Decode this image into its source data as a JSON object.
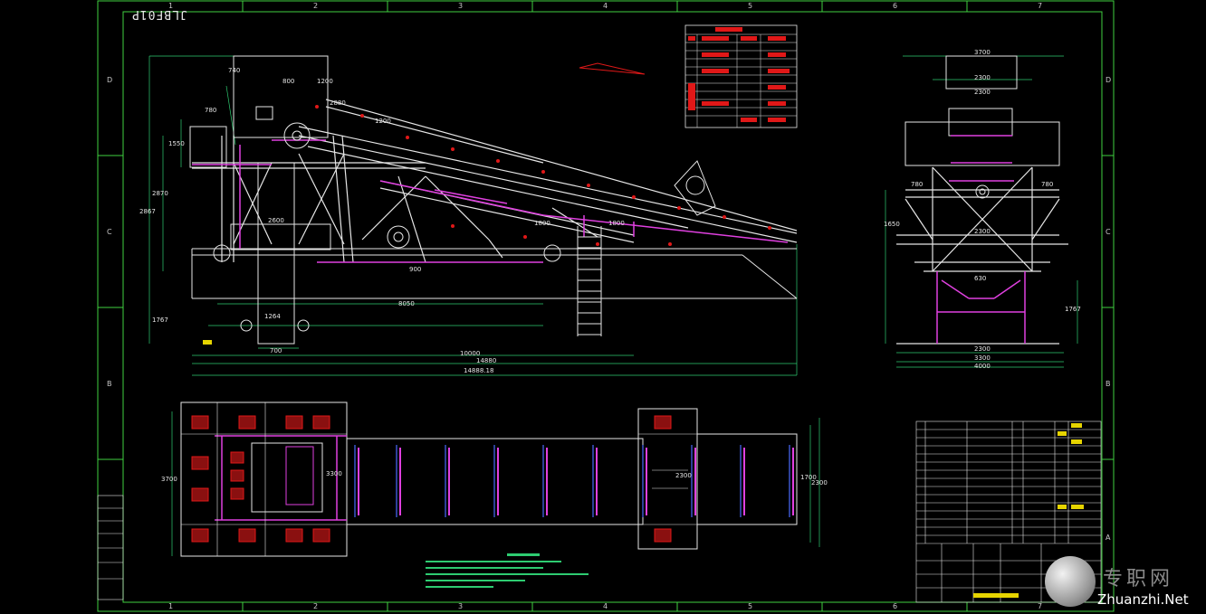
{
  "drawing": {
    "code_mirrored": "JLBF01P",
    "column_marks": [
      "1",
      "2",
      "3",
      "4",
      "5",
      "6",
      "7"
    ],
    "row_marks": [
      "D",
      "C",
      "B",
      "A"
    ],
    "dimensions_elevation": [
      "740",
      "800",
      "1200",
      "2880",
      "780",
      "1550",
      "2870",
      "2867",
      "1767",
      "1200",
      "2600",
      "1800",
      "1800",
      "8050",
      "1264",
      "700",
      "10000",
      "14880",
      "14888.18",
      "900"
    ],
    "dimensions_end": [
      "3700",
      "2300",
      "2300",
      "780",
      "780",
      "1650",
      "2300",
      "1767",
      "2300",
      "3300",
      "4000",
      "630"
    ],
    "dimensions_plan": [
      "3700",
      "3300",
      "2300",
      "1700",
      "2300"
    ]
  },
  "watermark": {
    "text": "专职网",
    "url": "Zhuanzhi.Net"
  },
  "colors": {
    "frame": "#3fd13f",
    "steel": "#e6e6e6",
    "magenta": "#e040e0",
    "dim": "#2ecc71",
    "yellow": "#e6d400",
    "red": "#e01818",
    "blue": "#4a6cff"
  }
}
